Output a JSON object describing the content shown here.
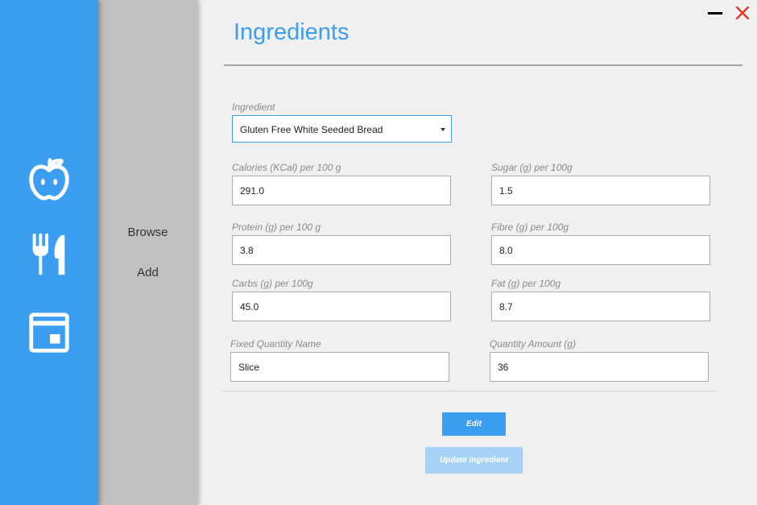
{
  "rail": {
    "items": [
      {
        "icon": "apple-icon",
        "label": ""
      },
      {
        "icon": "fork-knife-icon",
        "label": ""
      },
      {
        "icon": "calendar-icon",
        "label": ""
      }
    ]
  },
  "subnav": {
    "browse_label": "Browse",
    "add_label": "Add"
  },
  "window": {
    "minimize_icon": "minimize-icon",
    "close_icon": "close-icon",
    "close_color": "#e0372e"
  },
  "page": {
    "title": "Ingredients"
  },
  "form": {
    "ingredient": {
      "label": "Ingredient",
      "selected": "Gluten Free White Seeded Bread"
    },
    "calories": {
      "label": "Calories (KCal) per 100 g",
      "value": "291.0"
    },
    "sugar": {
      "label": "Sugar (g) per 100g",
      "value": "1.5"
    },
    "protein": {
      "label": "Protein (g) per 100 g",
      "value": "3.8"
    },
    "fibre": {
      "label": "Fibre (g) per 100g",
      "value": "8.0"
    },
    "carbs": {
      "label": "Carbs (g) per 100g",
      "value": "45.0"
    },
    "fat": {
      "label": "Fat (g) per 100g",
      "value": "8.7"
    },
    "fixed_quantity_name": {
      "label": "Fixed Quantity Name",
      "value": "Slice"
    },
    "quantity_amount": {
      "label": "Quantity Amount (g)",
      "value": "36"
    }
  },
  "actions": {
    "edit_label": "Edit",
    "update_label": "Update Ingredient"
  },
  "colors": {
    "accent": "#3b9ef0",
    "accent_disabled": "#a8d2f5",
    "subnav_bg": "#c1c1c1",
    "content_bg": "#f0f0f0"
  }
}
